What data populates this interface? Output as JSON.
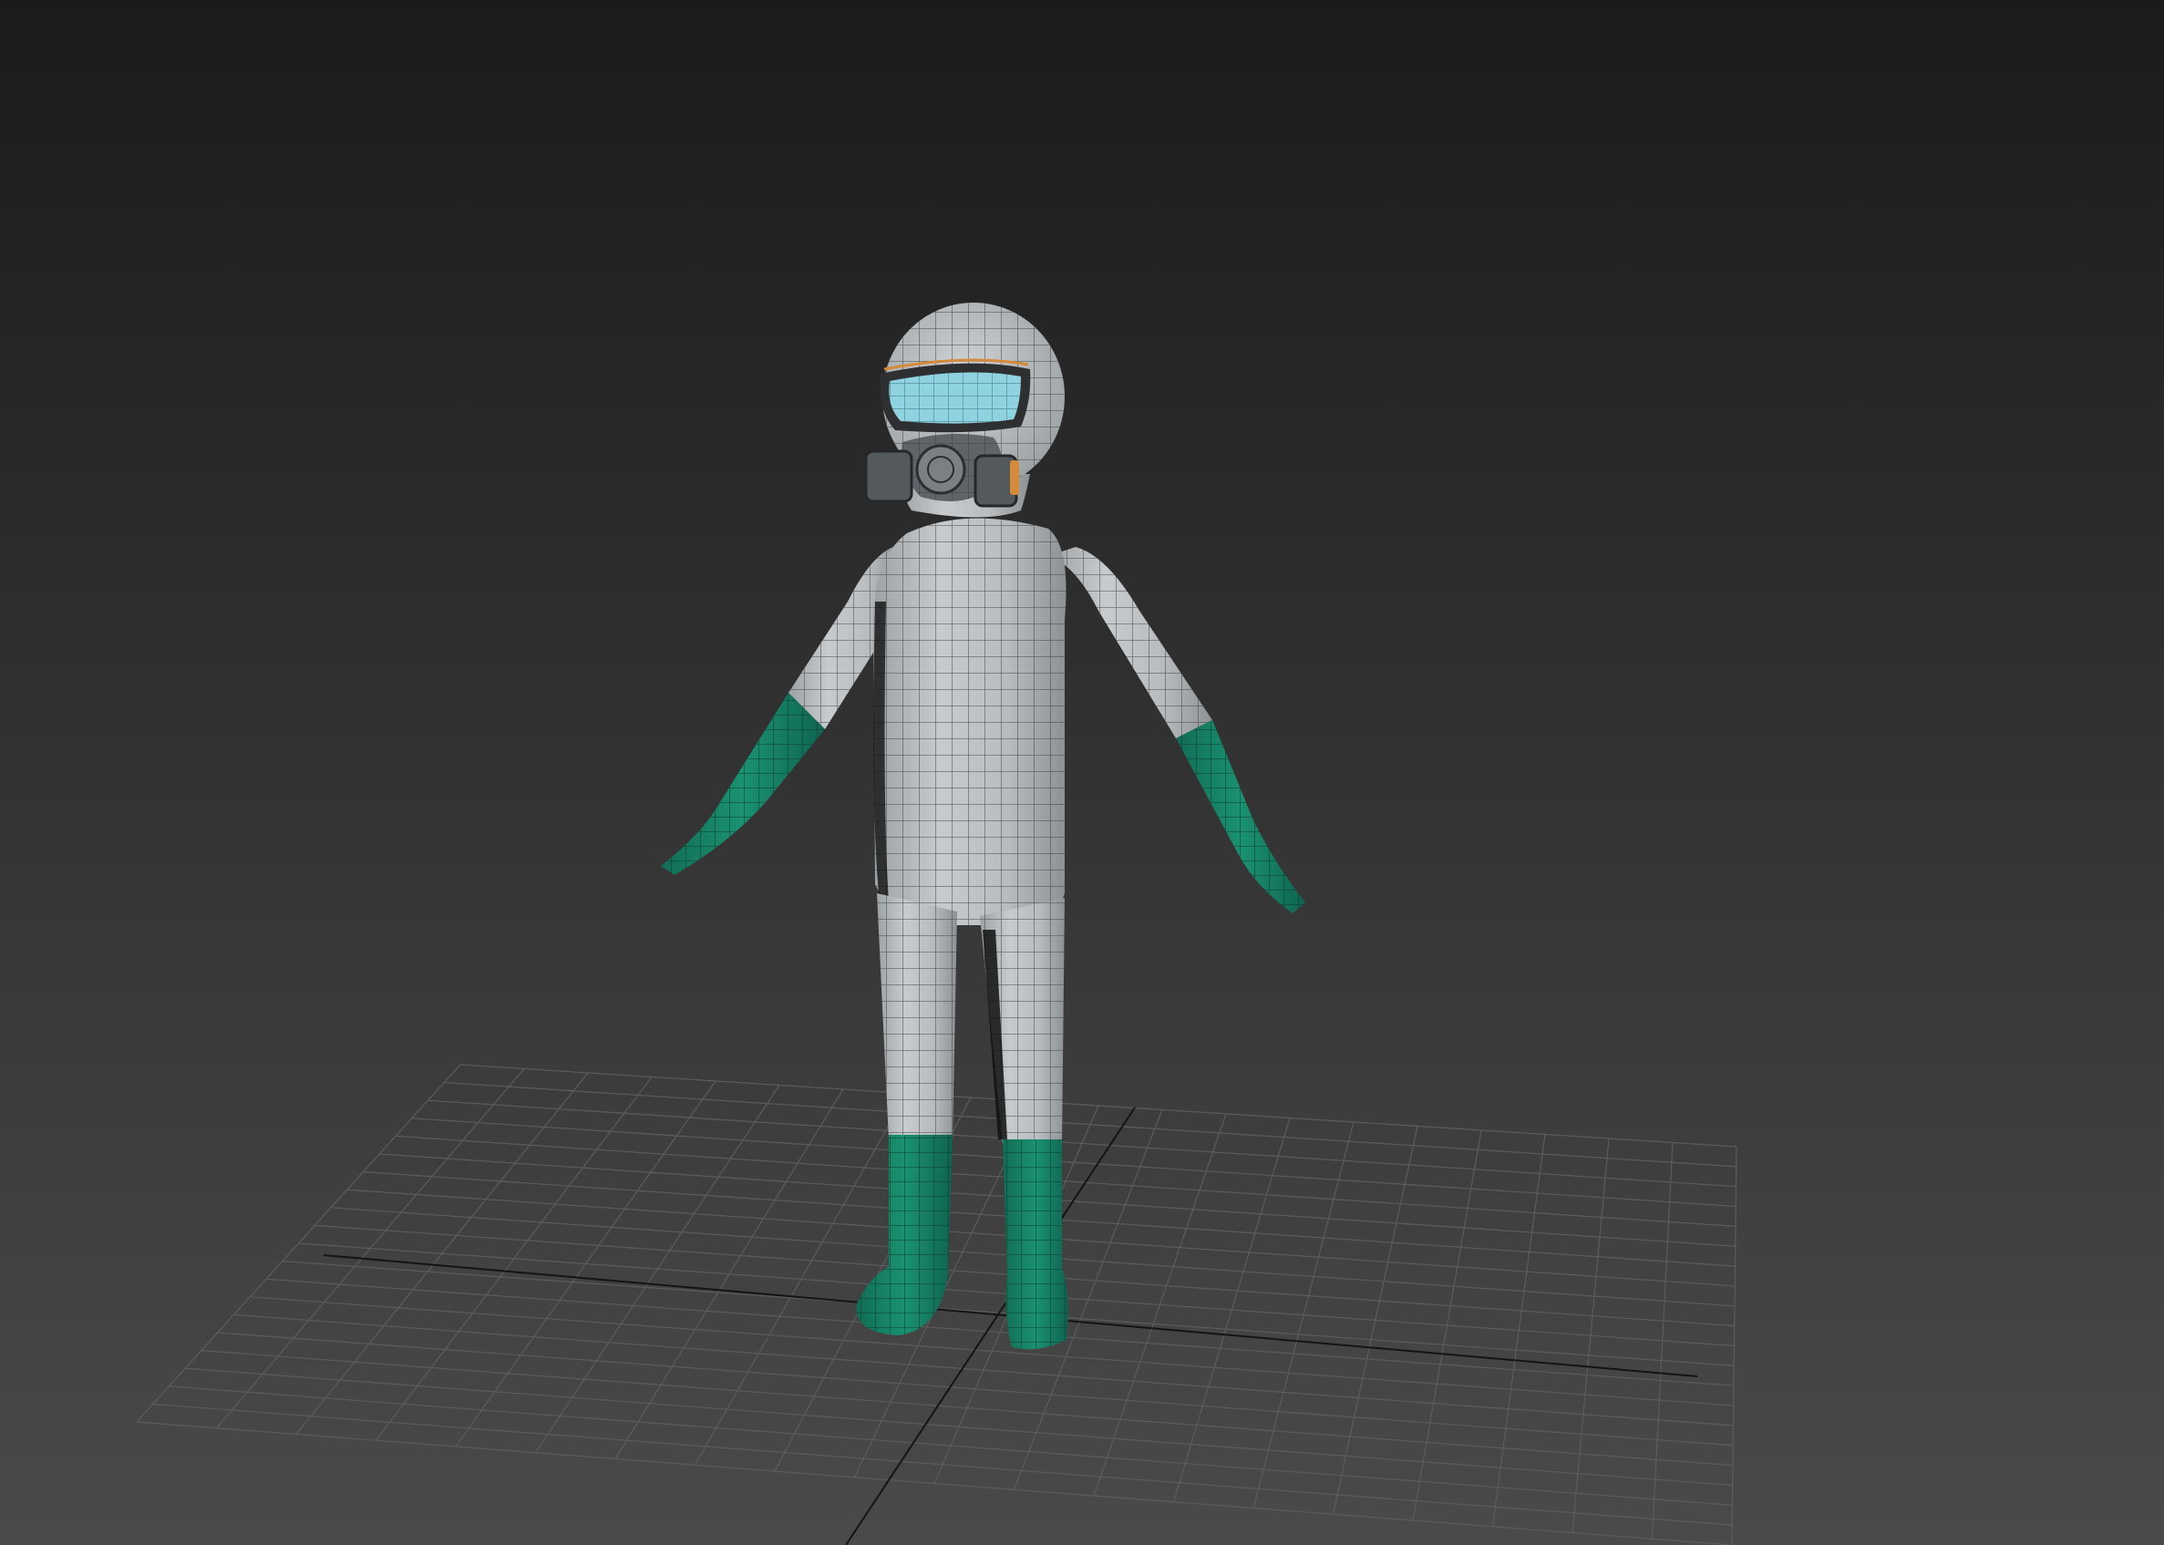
{
  "viewport": {
    "background_top": "#1b1b1b",
    "background_bottom": "#4a4a4a"
  },
  "grid": {
    "line_color": "#5c5c5c",
    "axis_color": "#111111"
  },
  "model": {
    "suit_color": "#b9bdc0",
    "suit_shade": "#8e9396",
    "wire_color": "#3b3f42",
    "glove_boot_color": "#17876a",
    "visor_color": "#8fd3e0",
    "mask_color": "#6a6f73",
    "accent_color": "#d58a3c"
  }
}
